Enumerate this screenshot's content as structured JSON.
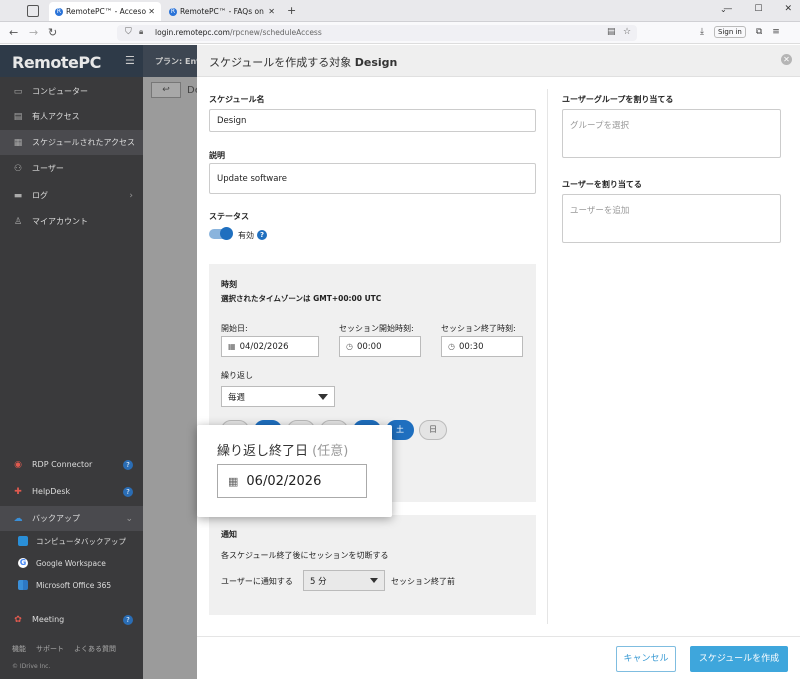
{
  "browser": {
    "tabs": [
      {
        "label": "RemotePC™ - Acceso programa",
        "active": true
      },
      {
        "label": "RemotePC™ - FAQs on Remote",
        "active": false
      }
    ],
    "url_host": "login.remotepc.com",
    "url_path": "/rpcnew/scheduleAccess",
    "signin_label": "Sign in"
  },
  "sidebar": {
    "logo": "RemotePC",
    "items": [
      {
        "label": "コンピューター",
        "icon": "monitor-icon"
      },
      {
        "label": "有人アクセス",
        "icon": "attended-icon"
      },
      {
        "label": "スケジュールされたアクセス",
        "icon": "calendar-clock-icon"
      },
      {
        "label": "ユーザー",
        "icon": "users-icon"
      },
      {
        "label": "ログ",
        "icon": "logs-icon"
      },
      {
        "label": "マイアカウント",
        "icon": "account-icon"
      }
    ],
    "lower_items": [
      {
        "label": "RDP Connector"
      },
      {
        "label": "HelpDesk"
      },
      {
        "label": "バックアップ"
      }
    ],
    "sub_items": [
      {
        "label": "コンピュータバックアップ"
      },
      {
        "label": "Google Workspace"
      },
      {
        "label": "Microsoft Office 365"
      }
    ],
    "meeting": "Meeting",
    "footer_links": [
      "機能",
      "サポート",
      "よくある質問"
    ],
    "copyright": "© IDrive Inc."
  },
  "background": {
    "plan_label": "プラン: Ente",
    "title_fragment": "De"
  },
  "panel": {
    "title_prefix": "スケジュールを作成する対象",
    "title_target": "Design",
    "name_label": "スケジュール名",
    "name_value": "Design",
    "desc_label": "説明",
    "desc_value": "Update software",
    "status_label": "ステータス",
    "status_value": "有効",
    "help_glyph": "?",
    "time": {
      "heading": "時刻",
      "timezone": "選択されたタイムゾーンは GMT+00:00 UTC",
      "start_date_label": "開始日:",
      "start_date": "04/02/2026",
      "session_start_label": "セッション開始時刻:",
      "session_start": "00:00",
      "session_end_label": "セッション終了時刻:",
      "session_end": "00:30",
      "repeat_label": "繰り返し",
      "repeat_value": "毎週",
      "days": [
        {
          "label": "",
          "on": false
        },
        {
          "label": "",
          "on": true
        },
        {
          "label": "",
          "on": false
        },
        {
          "label": "",
          "on": false
        },
        {
          "label": "",
          "on": true
        },
        {
          "label": "土",
          "on": true
        },
        {
          "label": "日",
          "on": false
        }
      ]
    },
    "notify": {
      "heading": "通知",
      "desc": "各スケジュール終了後にセッションを切断する",
      "notify_label": "ユーザーに通知する",
      "minutes": "5 分",
      "suffix": "セッション終了前"
    },
    "group_label": "ユーザーグループを割り当てる",
    "group_placeholder": "グループを選択",
    "user_label": "ユーザーを割り当てる",
    "user_placeholder": "ユーザーを追加",
    "cancel": "キャンセル",
    "create": "スケジュールを作成"
  },
  "callout": {
    "title": "繰り返し終了日",
    "optional": "(任意)",
    "date": "06/02/2026"
  },
  "colors": {
    "accent": "#1f6fbf",
    "primary_button": "#3ea6dc",
    "sidebar": "#3a3a3c"
  }
}
